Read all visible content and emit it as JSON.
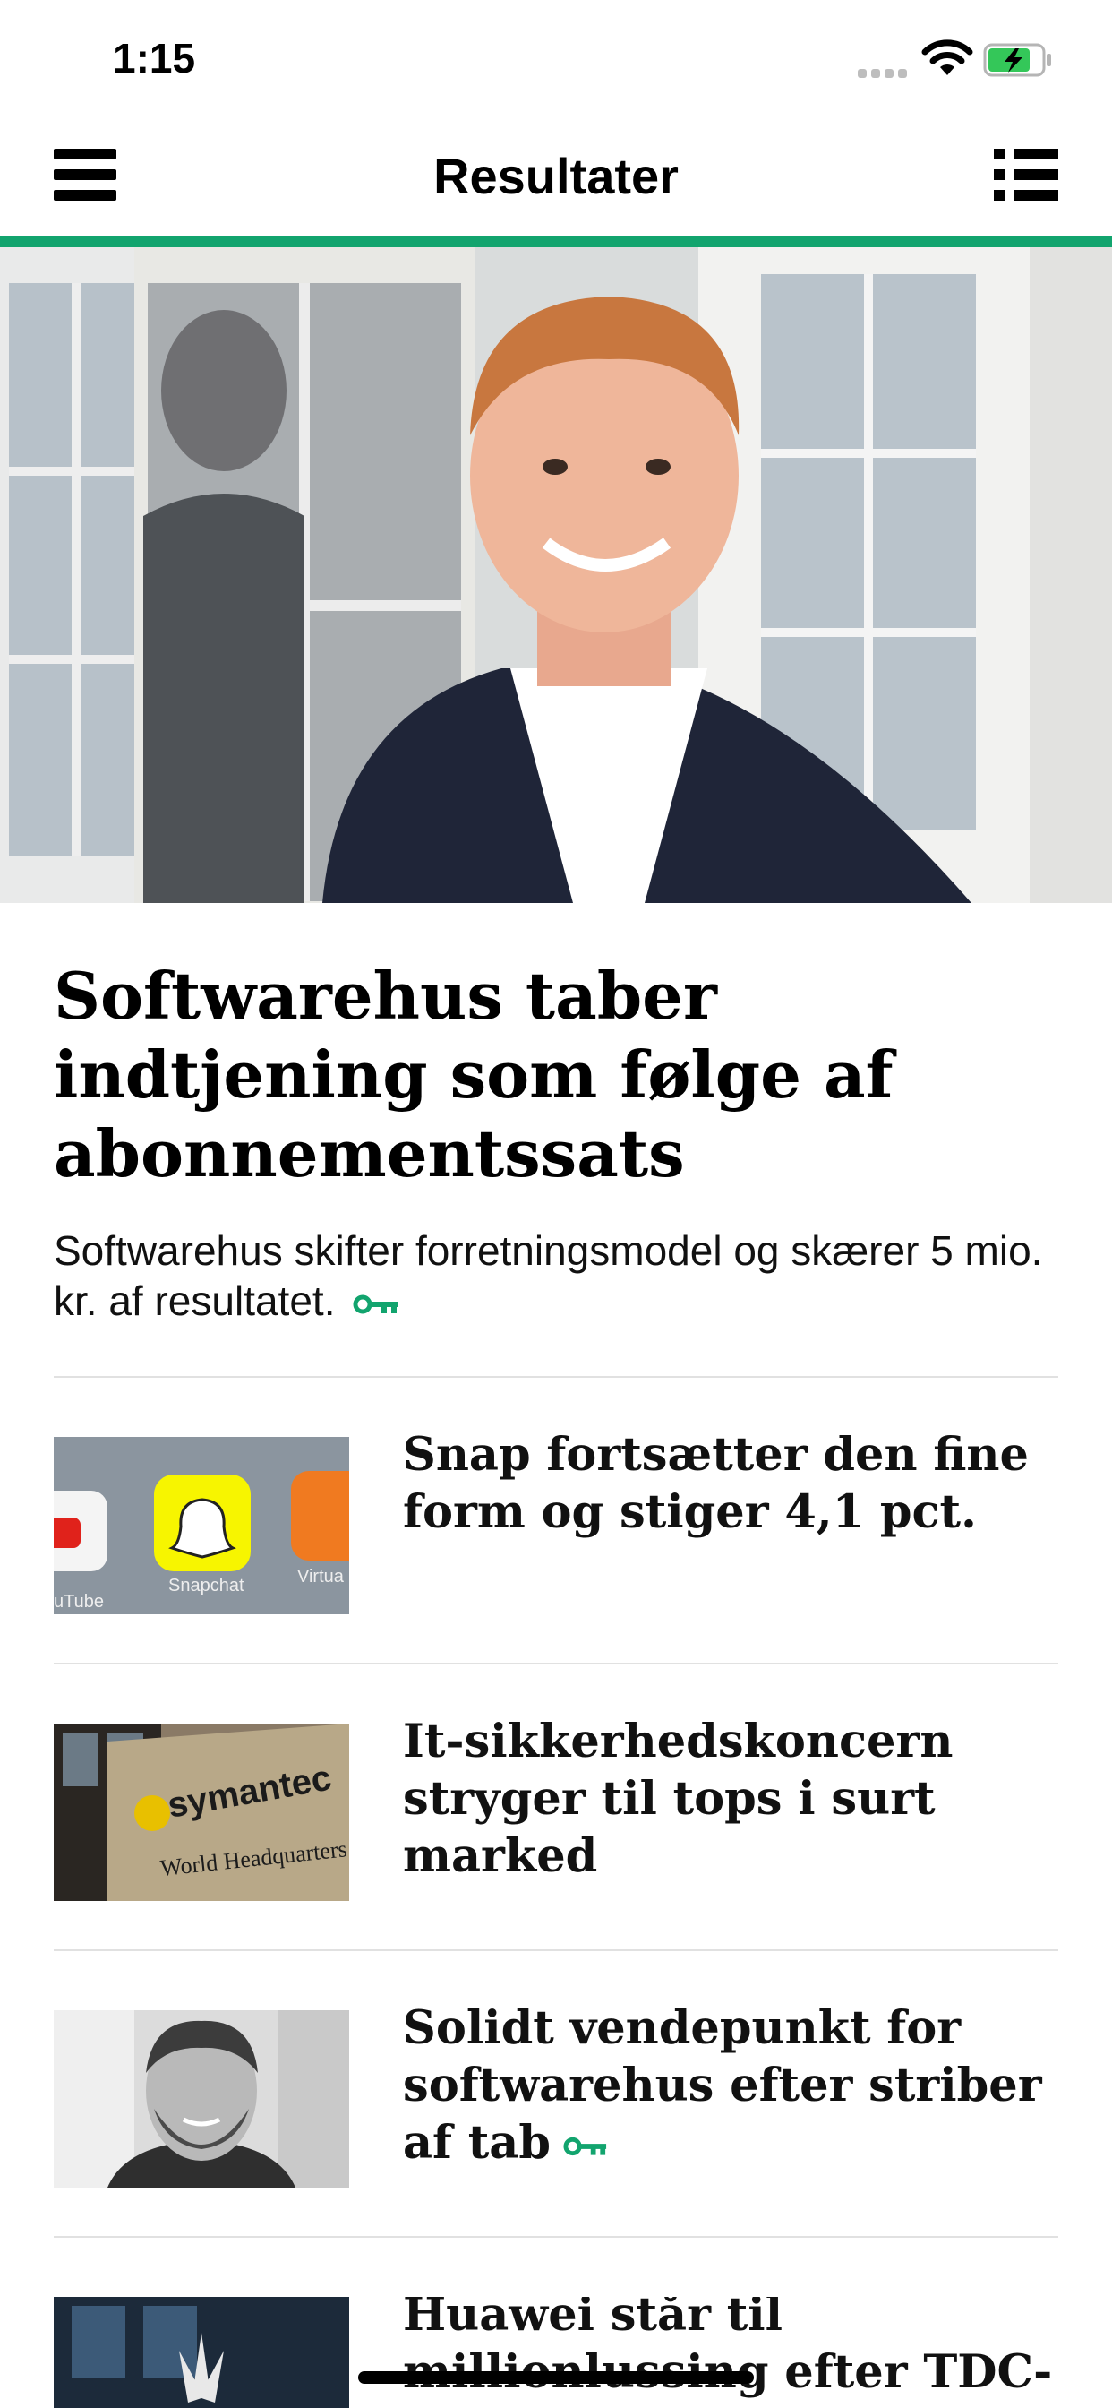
{
  "status_bar": {
    "time": "1:15"
  },
  "nav": {
    "title": "Resultater",
    "menu_icon": "hamburger-menu-icon",
    "list_icon": "list-view-icon"
  },
  "colors": {
    "accent": "#12a46e",
    "text": "#111111"
  },
  "hero": {
    "title": "Softwarehus taber indtjening som følge af abonnementssats",
    "summary": "Softwarehus skifter forretningsmodel og skærer 5 mio. kr. af resultatet.",
    "premium_icon": "key-icon"
  },
  "articles": [
    {
      "title": "Snap fortsætter den fine form og stiger 4,1 pct.",
      "premium": false
    },
    {
      "title": "It-sikkerhedskoncern stryger til tops i surt marked",
      "premium": false
    },
    {
      "title": "Solidt vendepunkt for softwarehus efter striber af tab",
      "premium": true
    },
    {
      "title": "Huawei står til millionlussing efter TDC-",
      "premium": false
    }
  ],
  "thumbnail_text": {
    "snapchat_label": "Snapchat",
    "youtube_label": "uTube",
    "virtual_label": "Virtua",
    "sign_brand": "symantec",
    "sign_text": "World Headquarters"
  }
}
